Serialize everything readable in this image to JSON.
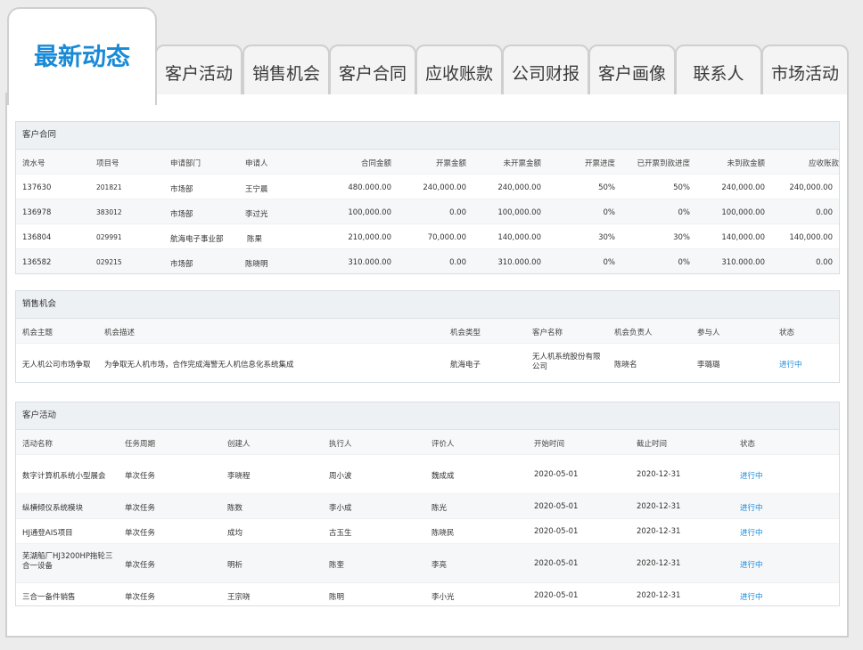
{
  "tabs": {
    "active": "最新动态",
    "items": [
      "客户活动",
      "销售机会",
      "客户合同",
      "应收账款",
      "公司财报",
      "客户画像",
      "联系人",
      "市场活动"
    ]
  },
  "contract": {
    "title": "客户合同",
    "headers": [
      "流水号",
      "项目号",
      "申请部门",
      "申请人",
      "合同金额",
      "开票金额",
      "未开票金额",
      "开票进度",
      "已开票到款进度",
      "未到款金额",
      "应收账款"
    ],
    "rows": [
      [
        "137630",
        "201821",
        "市场部",
        "王宁晨",
        "480.000.00",
        "240,000.00",
        "240,000.00",
        "50%",
        "50%",
        "240,000.00",
        "240,000.00"
      ],
      [
        "136978",
        "383012",
        "市场部",
        "李过光",
        "100,000.00",
        "0.00",
        "100,000.00",
        "0%",
        "0%",
        "100,000.00",
        "0.00"
      ],
      [
        "136804",
        "029991",
        "航海电子事业部",
        "陈果",
        "210,000.00",
        "70,000.00",
        "140,000.00",
        "30%",
        "30%",
        "140,000.00",
        "140,000.00"
      ],
      [
        "136582",
        "029215",
        "市场部",
        "陈晓明",
        "310.000.00",
        "0.00",
        "310.000.00",
        "0%",
        "0%",
        "310.000.00",
        "0.00"
      ]
    ]
  },
  "opportunity": {
    "title": "销售机会",
    "headers": [
      "机会主题",
      "机会描述",
      "机会类型",
      "客户名称",
      "机会负责人",
      "参与人",
      "状态"
    ],
    "rows": [
      [
        "无人机公司市场争取",
        "为争取无人机市场，合作完成海警无人机信息化系统集成",
        "航海电子",
        "无人机系统股份有限公司",
        "陈晓名",
        "李璐璐",
        "进行中"
      ]
    ]
  },
  "activity": {
    "title": "客户活动",
    "headers": [
      "活动名称",
      "任务周期",
      "创建人",
      "执行人",
      "评价人",
      "开始时间",
      "截止时间",
      "状态"
    ],
    "rows": [
      [
        "数字计算机系统小型展会",
        "单次任务",
        "李晓程",
        "周小波",
        "魏成成",
        "2020-05-01",
        "2020-12-31",
        "进行中"
      ],
      [
        "纵横倾仪系统模块",
        "单次任务",
        "陈数",
        "李小成",
        "陈光",
        "2020-05-01",
        "2020-12-31",
        "进行中"
      ],
      [
        "HJ通登AIS项目",
        "单次任务",
        "成均",
        "古玉生",
        "陈晓民",
        "2020-05-01",
        "2020-12-31",
        "进行中"
      ],
      [
        "芜湖船厂HJ3200HP拖轮三合一设备",
        "单次任务",
        "明析",
        "陈奎",
        "李亮",
        "2020-05-01",
        "2020-12-31",
        "进行中"
      ],
      [
        "三合一备件销售",
        "单次任务",
        "王宗晓",
        "陈明",
        "李小光",
        "2020-05-01",
        "2020-12-31",
        "进行中"
      ]
    ]
  },
  "colors": {
    "accent": "#1a8ad6",
    "header_bg": "#eef1f4"
  }
}
